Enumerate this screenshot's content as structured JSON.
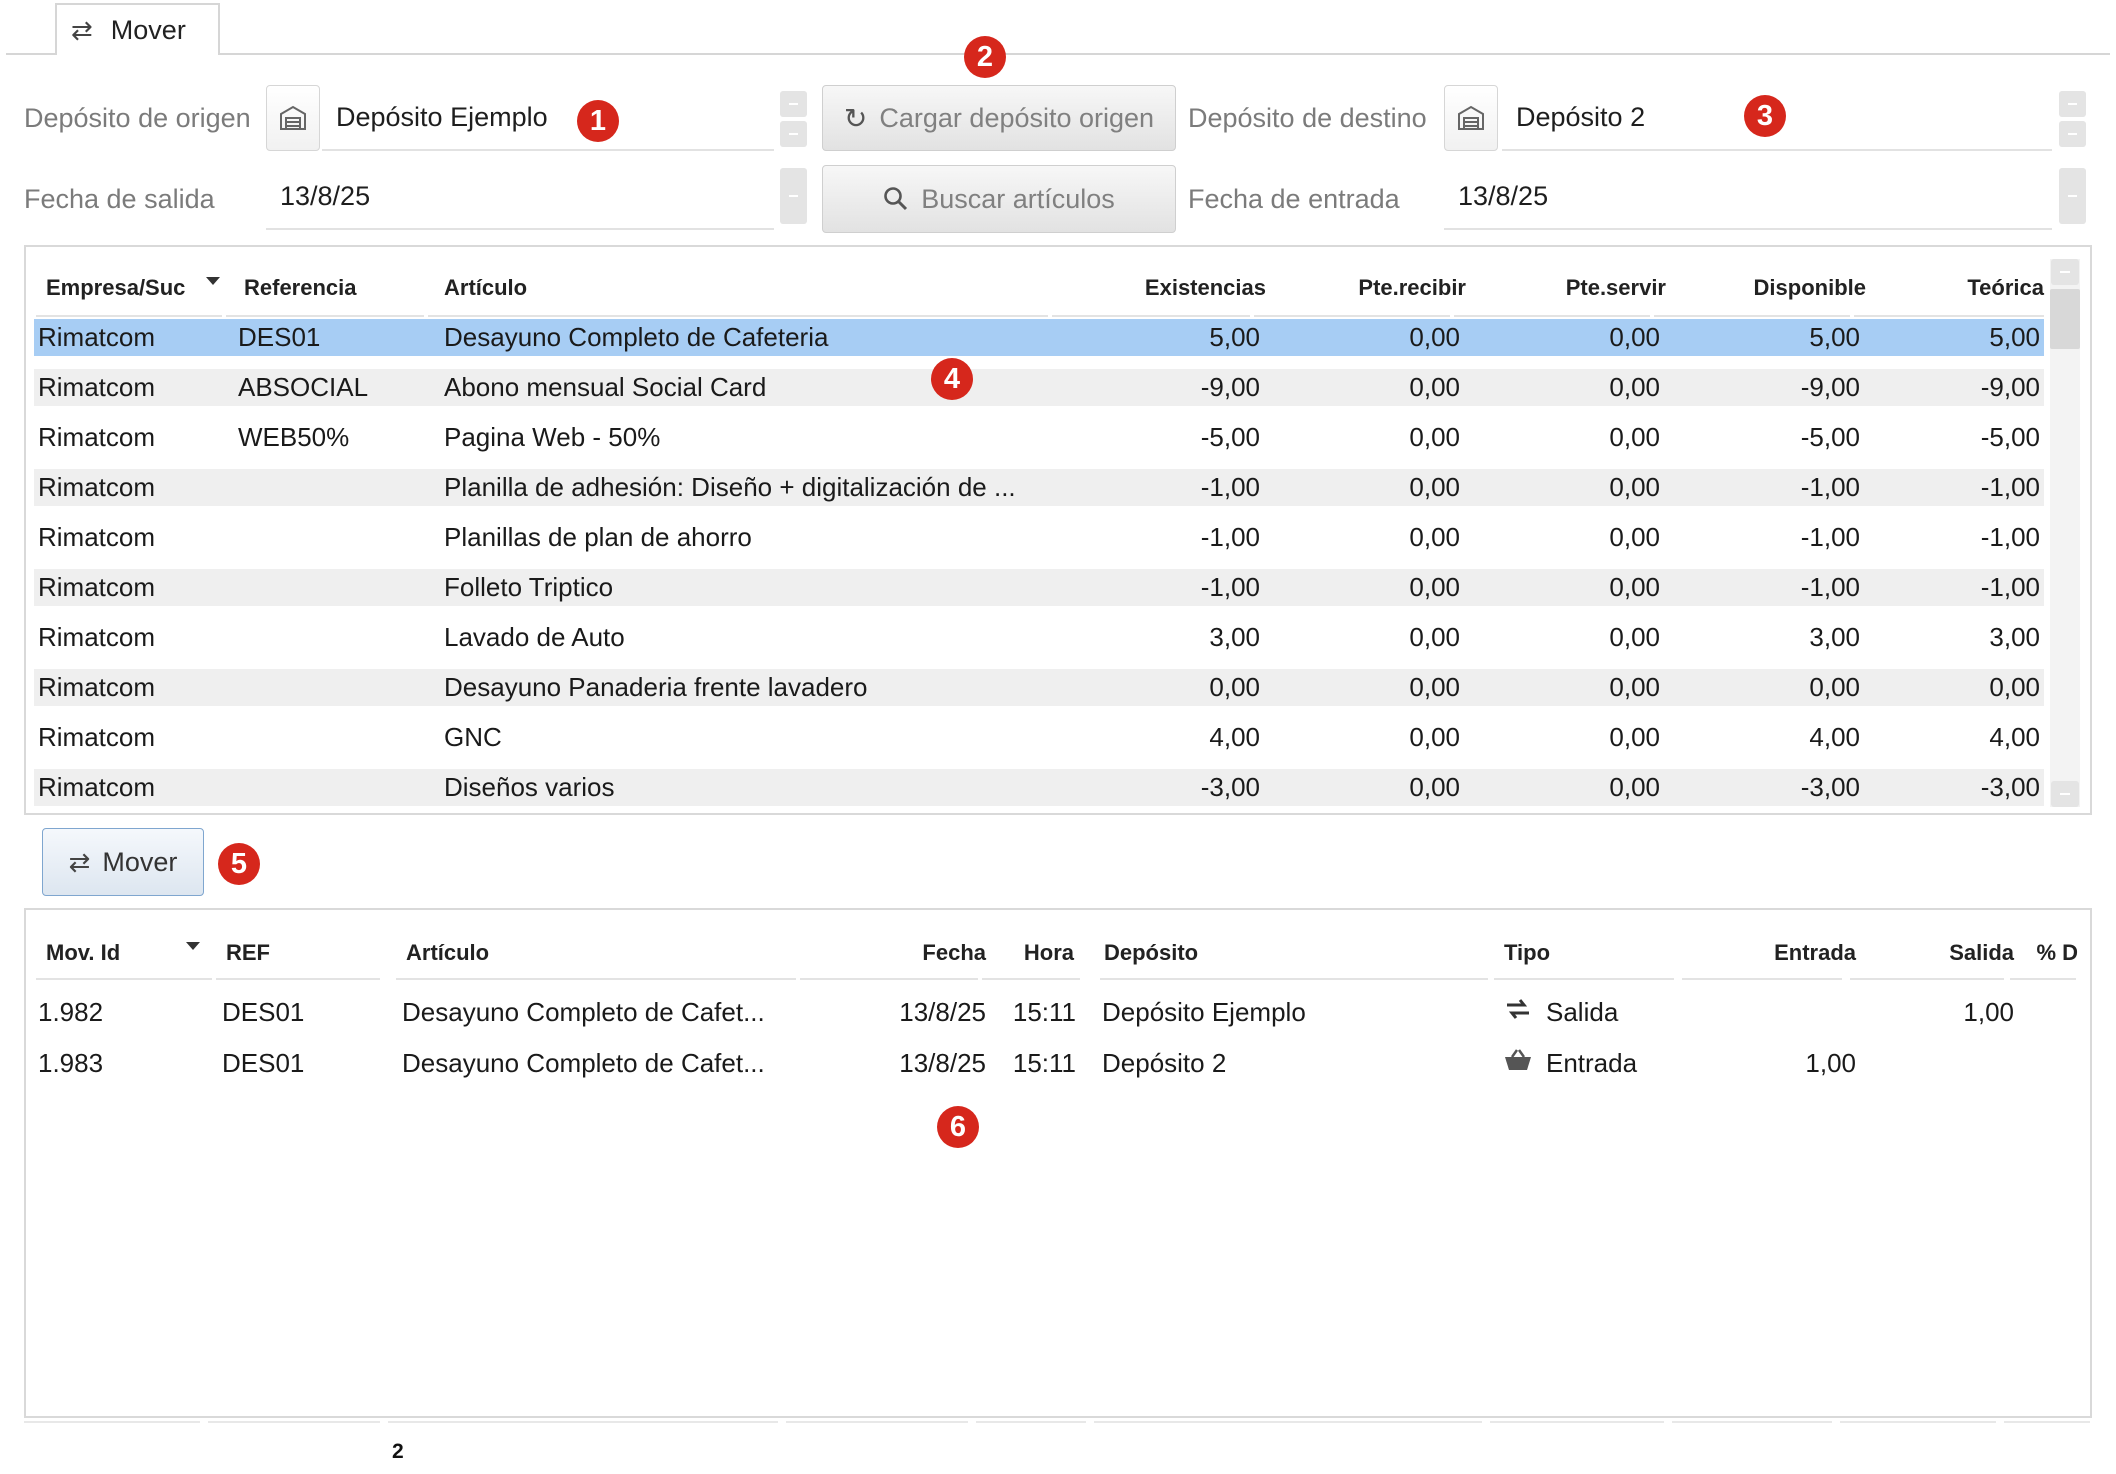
{
  "tab": {
    "label": "Mover",
    "icon": "swap-arrows-icon"
  },
  "form": {
    "origin_label": "Depósito de origen",
    "origin_value": "Depósito Ejemplo",
    "load_button": "Cargar depósito origen",
    "dest_label": "Depósito de destino",
    "dest_value": "Depósito 2",
    "departure_label": "Fecha de salida",
    "departure_value": "13/8/25",
    "search_button": "Buscar artículos",
    "arrival_label": "Fecha de entrada",
    "arrival_value": "13/8/25"
  },
  "badges": [
    "1",
    "2",
    "3",
    "4",
    "5",
    "6"
  ],
  "stock_table": {
    "columns": [
      "Empresa/Suc",
      "Referencia",
      "Artículo",
      "Existencias",
      "Pte.recibir",
      "Pte.servir",
      "Disponible",
      "Teórica"
    ],
    "rows": [
      [
        "Rimatcom",
        "DES01",
        "Desayuno Completo de Cafeteria",
        "5,00",
        "0,00",
        "0,00",
        "5,00",
        "5,00"
      ],
      [
        "Rimatcom",
        "ABSOCIAL",
        "Abono mensual Social Card",
        "-9,00",
        "0,00",
        "0,00",
        "-9,00",
        "-9,00"
      ],
      [
        "Rimatcom",
        "WEB50%",
        "Pagina Web - 50%",
        "-5,00",
        "0,00",
        "0,00",
        "-5,00",
        "-5,00"
      ],
      [
        "Rimatcom",
        "",
        "Planilla de adhesión: Diseño + digitalización de ...",
        "-1,00",
        "0,00",
        "0,00",
        "-1,00",
        "-1,00"
      ],
      [
        "Rimatcom",
        "",
        "Planillas de plan de ahorro",
        "-1,00",
        "0,00",
        "0,00",
        "-1,00",
        "-1,00"
      ],
      [
        "Rimatcom",
        "",
        "Folleto Triptico",
        "-1,00",
        "0,00",
        "0,00",
        "-1,00",
        "-1,00"
      ],
      [
        "Rimatcom",
        "",
        "Lavado de Auto",
        "3,00",
        "0,00",
        "0,00",
        "3,00",
        "3,00"
      ],
      [
        "Rimatcom",
        "",
        "Desayuno Panaderia frente lavadero",
        "0,00",
        "0,00",
        "0,00",
        "0,00",
        "0,00"
      ],
      [
        "Rimatcom",
        "",
        "GNC",
        "4,00",
        "0,00",
        "0,00",
        "4,00",
        "4,00"
      ],
      [
        "Rimatcom",
        "",
        "Diseños varios",
        "-3,00",
        "0,00",
        "0,00",
        "-3,00",
        "-3,00"
      ]
    ],
    "selected_row": 0
  },
  "move_button": "Mover",
  "movements_table": {
    "columns": [
      "Mov. Id",
      "REF",
      "Artículo",
      "Fecha",
      "Hora",
      "Depósito",
      "Tipo",
      "Entrada",
      "Salida",
      "% D"
    ],
    "rows": [
      {
        "id": "1.982",
        "ref": "DES01",
        "article": "Desayuno Completo de Cafet...",
        "date": "13/8/25",
        "time": "15:11",
        "deposit": "Depósito Ejemplo",
        "type": "Salida",
        "type_icon": "truck-out-icon",
        "entrada": "",
        "salida": "1,00"
      },
      {
        "id": "1.983",
        "ref": "DES01",
        "article": "Desayuno Completo de Cafet...",
        "date": "13/8/25",
        "time": "15:11",
        "deposit": "Depósito 2",
        "type": "Entrada",
        "type_icon": "basket-icon",
        "entrada": "1,00",
        "salida": ""
      }
    ],
    "footer_count": "2"
  },
  "colors": {
    "badge": "#d6271c",
    "selected_row": "#a7cdf4",
    "alt_row": "#efefef"
  }
}
